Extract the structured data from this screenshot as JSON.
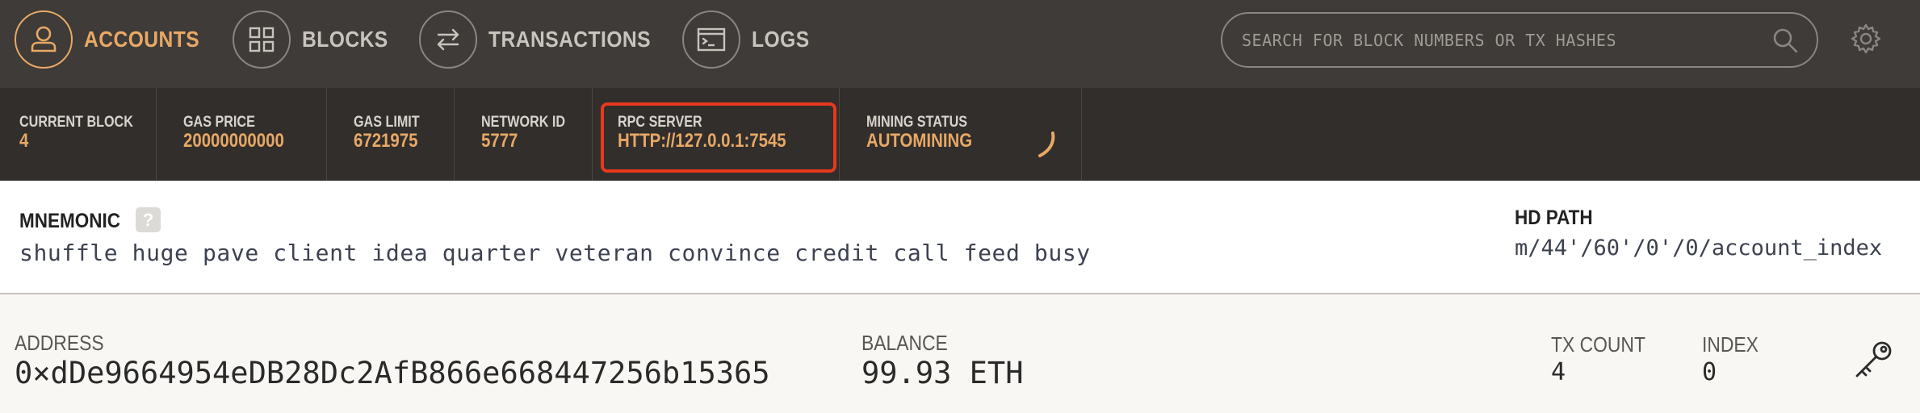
{
  "nav": {
    "items": [
      {
        "label": "ACCOUNTS",
        "icon": "user-icon",
        "active": true
      },
      {
        "label": "BLOCKS",
        "icon": "grid-icon",
        "active": false
      },
      {
        "label": "TRANSACTIONS",
        "icon": "swap-arrows-icon",
        "active": false
      },
      {
        "label": "LOGS",
        "icon": "terminal-icon",
        "active": false
      }
    ],
    "search_placeholder": "SEARCH FOR BLOCK NUMBERS OR TX HASHES",
    "settings_icon": "gear-icon"
  },
  "status": {
    "current_block": {
      "label": "CURRENT BLOCK",
      "value": "4"
    },
    "gas_price": {
      "label": "GAS PRICE",
      "value": "20000000000"
    },
    "gas_limit": {
      "label": "GAS LIMIT",
      "value": "6721975"
    },
    "network_id": {
      "label": "NETWORK ID",
      "value": "5777"
    },
    "rpc_server": {
      "label": "RPC SERVER",
      "value": "HTTP://127.0.0.1:7545"
    },
    "mining_status": {
      "label": "MINING STATUS",
      "value": "AUTOMINING"
    }
  },
  "mnemonic": {
    "label": "MNEMONIC",
    "help": "?",
    "words": "shuffle huge pave client idea quarter veteran convince credit call feed busy",
    "hd_path_label": "HD PATH",
    "hd_path": "m/44'/60'/0'/0/account_index"
  },
  "account": {
    "address_label": "ADDRESS",
    "address": "0×dDe9664954eDB28Dc2AfB866e668447256b15365",
    "balance_label": "BALANCE",
    "balance": "99.93 ETH",
    "tx_count_label": "TX COUNT",
    "tx_count": "4",
    "index_label": "INDEX",
    "index": "0"
  },
  "colors": {
    "accent": "#e8a865",
    "highlight_box": "#e8391c",
    "nav_bg": "#3e3b38",
    "status_bg": "#312e2c"
  }
}
